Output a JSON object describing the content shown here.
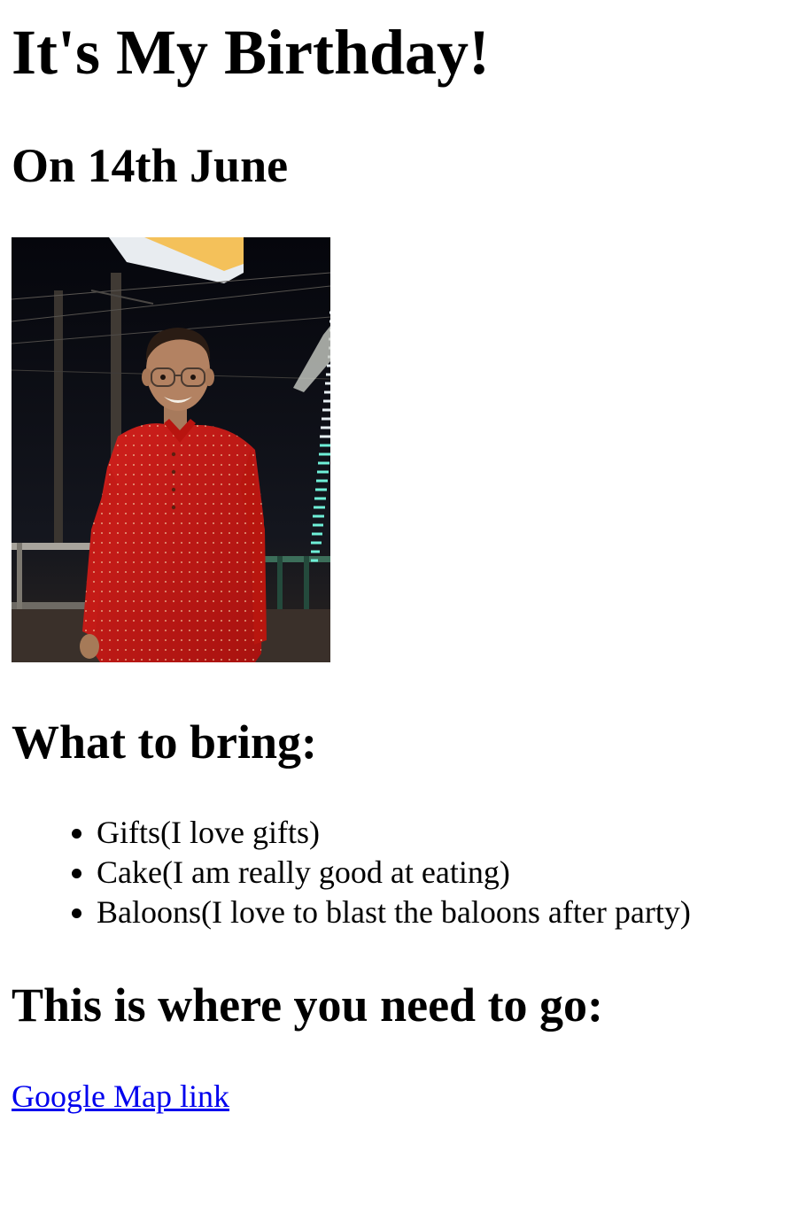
{
  "header": {
    "title": "It's My Birthday!",
    "date": "On 14th June"
  },
  "photo": {
    "description_icon": "photo-person-icon"
  },
  "bring": {
    "heading": "What to bring:",
    "items": [
      "Gifts(I love gifts)",
      "Cake(I am really good at eating)",
      "Baloons(I love to blast the baloons after party)"
    ]
  },
  "location": {
    "heading": "This is where you need to go:",
    "link_label": "Google Map link"
  },
  "colors": {
    "link": "#0000ee",
    "text": "#000000",
    "background": "#ffffff"
  }
}
